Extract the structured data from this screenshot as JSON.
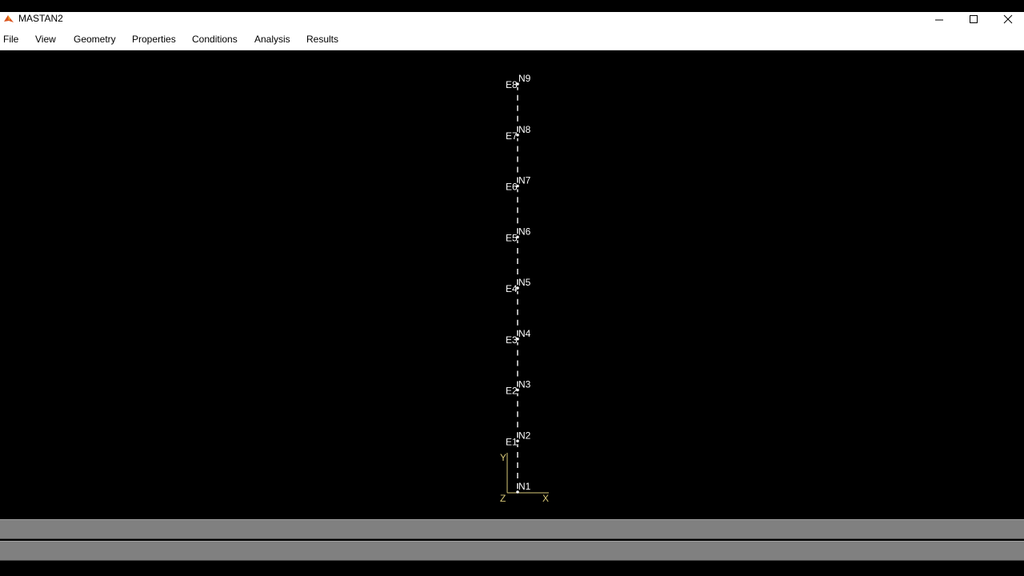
{
  "window": {
    "title": "MASTAN2"
  },
  "menu": {
    "items": [
      "File",
      "View",
      "Geometry",
      "Properties",
      "Conditions",
      "Analysis",
      "Results"
    ]
  },
  "model": {
    "nodes": [
      "N1",
      "N2",
      "N3",
      "N4",
      "N5",
      "N6",
      "N7",
      "N8",
      "N9"
    ],
    "elements": [
      "E1",
      "E2",
      "E3",
      "E4",
      "E5",
      "E6",
      "E7",
      "E8"
    ],
    "axes": {
      "x": "X",
      "y": "Y",
      "z": "Z"
    }
  },
  "colors": {
    "background": "#000000",
    "model": "#ffffff",
    "axes": "#d8c878",
    "status_panel": "#808080"
  },
  "status": {
    "line1": "",
    "line2": ""
  },
  "icons": {
    "app": "matlab-icon",
    "minimize": "minimize-icon",
    "maximize": "maximize-icon",
    "close": "close-icon"
  }
}
